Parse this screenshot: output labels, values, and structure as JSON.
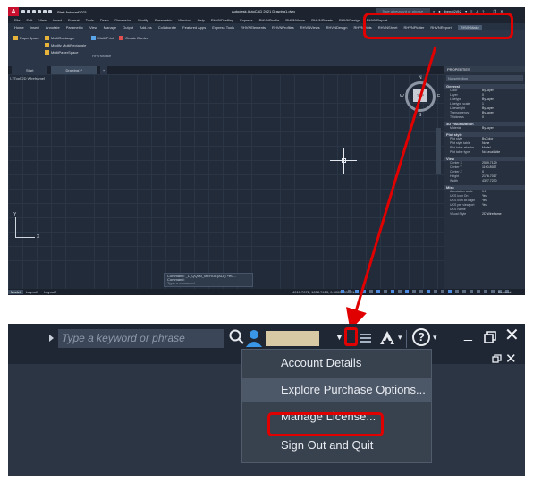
{
  "acad": {
    "logo": "A",
    "file_tag": "Start  Autocad2021",
    "app_title": "Autodesk AutoCAD 2021  Drawing1.dwg",
    "search_placeholder": "Type a keyword or phrase",
    "user": "jbendt2@2",
    "menu": [
      "File",
      "Edit",
      "View",
      "Insert",
      "Format",
      "Tools",
      "Draw",
      "Dimension",
      "Modify",
      "Parametric",
      "Window",
      "Help",
      "RHVNDrafting",
      "Express",
      "RHVNProfile",
      "RHVNViews",
      "RHVNSheets",
      "RHVNDesign",
      "RHVNReport"
    ],
    "ribbon_tabs": [
      "Home",
      "Insert",
      "Annotate",
      "Parametric",
      "View",
      "Manage",
      "Output",
      "Add-ins",
      "Collaborate",
      "Featured Apps",
      "Express Tools",
      "RHVNElements",
      "RHVNProfiles",
      "RHVNViews",
      "RHVNDesign",
      "RHVNPlots",
      "RHVNSheet",
      "RHVNPlotter",
      "RHVNReport",
      "RHVNMake"
    ],
    "ribbon_active": "RHVNMake",
    "ribbon": {
      "col1": [
        "PaperSpace"
      ],
      "col2": [
        "MultiRectangle",
        "Modify MultiRectangle",
        "MultiPaperSpace"
      ],
      "col3": [
        "Multi Print"
      ],
      "col4": [
        "Create Border"
      ],
      "panel": "RHVNMake"
    },
    "doc_tabs": [
      "Start",
      "Drawing1*",
      "+"
    ],
    "view_label": "[-][Top][2D Wireframe]",
    "viewcube": {
      "top": "TOP",
      "n": "N",
      "s": "S",
      "w": "W",
      "e": "E"
    },
    "ucs": {
      "x": "X",
      "y": "Y"
    },
    "command_lines": [
      "Command: _L_QQQ0_MERGE(ALL) +e0...",
      "Command:",
      "Type a command"
    ],
    "properties": {
      "title": "PROPERTIES",
      "selection": "No selection",
      "sections": [
        {
          "name": "General",
          "rows": [
            [
              "Color",
              "ByLayer"
            ],
            [
              "Layer",
              "0"
            ],
            [
              "Linetype",
              "ByLayer"
            ],
            [
              "Linetype scale",
              "1"
            ],
            [
              "Lineweight",
              "ByLayer"
            ],
            [
              "Transparency",
              "ByLayer"
            ],
            [
              "Thickness",
              "0"
            ]
          ]
        },
        {
          "name": "3D Visualization",
          "rows": [
            [
              "Material",
              "ByLayer"
            ]
          ]
        },
        {
          "name": "Plot style",
          "rows": [
            [
              "Plot style",
              "ByColor"
            ],
            [
              "Plot style table",
              "None"
            ],
            [
              "Plot table attache",
              "Model"
            ],
            [
              "Plot table type",
              "Not available"
            ]
          ]
        },
        {
          "name": "View",
          "rows": [
            [
              "Center X",
              "2549.7129"
            ],
            [
              "Center Y",
              "1190.8927"
            ],
            [
              "Center Z",
              "0"
            ],
            [
              "Height",
              "2176.7017"
            ],
            [
              "Width",
              "4327.7230"
            ]
          ]
        },
        {
          "name": "Misc",
          "rows": [
            [
              "Annotation scale",
              "1:1"
            ],
            [
              "UCS icon On",
              "Yes"
            ],
            [
              "UCS icon at origin",
              "Yes"
            ],
            [
              "UCS per viewport",
              "Yes"
            ],
            [
              "UCS Name",
              ""
            ],
            [
              "Visual Style",
              "2D Wireframe"
            ]
          ]
        }
      ]
    },
    "status_tabs": [
      "Model",
      "Layout1",
      "Layout2",
      "+"
    ],
    "coords": "4010.7072, 1658.7413, 0.0000  MODEL",
    "decimal": "Decimal"
  },
  "zoom": {
    "search_placeholder": "Type a keyword or phrase",
    "help": "?",
    "menu_items": [
      "Account Details",
      "Explore Purchase Options...",
      "Manage License...",
      "Sign Out and Quit"
    ]
  },
  "colors": {
    "highlight": "#e00000",
    "accent_blue": "#3a97e8"
  },
  "icons": [
    "autocad-logo-icon",
    "search-icon",
    "user-icon",
    "chevron-down-icon",
    "cart-icon",
    "autodesk-icon",
    "help-icon",
    "minimize-icon",
    "restore-icon",
    "close-icon"
  ]
}
